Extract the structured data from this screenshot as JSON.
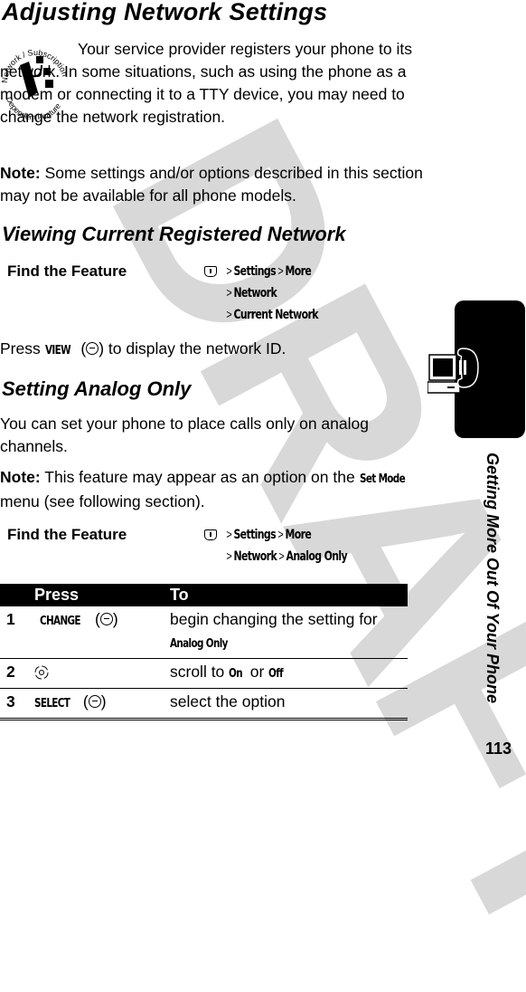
{
  "watermark": "DRAFT",
  "title": "Adjusting Network Settings",
  "feature_badge": {
    "top_text": "Network / Subscription",
    "bottom_text": "Dependent Feature"
  },
  "intro": "Your service provider registers your phone to its network. In some situations, such as using the phone as a modem or connecting it to a TTY device, you may need to change the network registration.",
  "note1": {
    "label": "Note:",
    "text": " Some settings and/or options described in this section may not be available for all phone models."
  },
  "section1": {
    "heading": "Viewing Current Registered Network",
    "find_label": "Find the Feature",
    "path_lines": [
      [
        "Settings",
        "More"
      ],
      [
        "Network"
      ],
      [
        "Current Network"
      ]
    ],
    "press_text": {
      "pre": "Press ",
      "key": "VIEW",
      "post": ") to display the network ID."
    }
  },
  "section2": {
    "heading": "Setting Analog Only",
    "body": "You can set your phone to place calls only on analog channels.",
    "note": {
      "label": "Note:",
      "pre": " This feature may appear as an option on the ",
      "key": "Set Mode",
      "post": " menu (see following section)."
    },
    "find_label": "Find the Feature",
    "path_lines": [
      [
        "Settings",
        "More"
      ],
      [
        "Network",
        "Analog Only"
      ]
    ]
  },
  "table": {
    "headers": [
      "Press",
      "To"
    ],
    "rows": [
      {
        "num": "1",
        "key": "CHANGE",
        "icon": "soft-key-icon",
        "to": "begin changing the setting for",
        "to_key": "Analog Only"
      },
      {
        "num": "2",
        "icon": "nav-key-icon",
        "to_pre": "scroll to ",
        "on": "On",
        "or": " or ",
        "off": "Off"
      },
      {
        "num": "3",
        "key": "SELECT",
        "icon": "soft-key-icon",
        "to": "select the option"
      }
    ]
  },
  "side": {
    "chapter": "Getting More Out Of Your Phone",
    "page": "113",
    "icon": "computer-phone-icon"
  }
}
